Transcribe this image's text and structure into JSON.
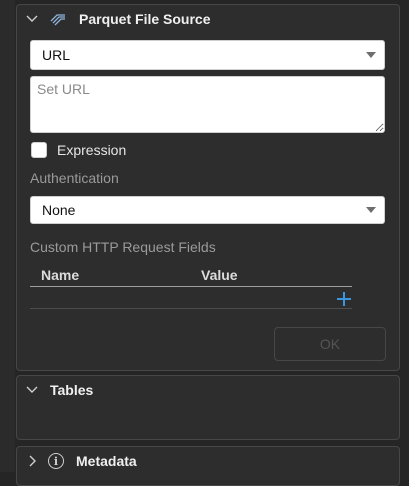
{
  "parquet_panel": {
    "title": "Parquet File Source",
    "source_type": {
      "selected": "URL"
    },
    "url": {
      "value": "",
      "placeholder": "Set URL"
    },
    "expression": {
      "label": "Expression",
      "checked": false
    },
    "authentication": {
      "label": "Authentication",
      "selected": "None"
    },
    "custom_fields": {
      "label": "Custom HTTP Request Fields",
      "columns": [
        "Name",
        "Value"
      ],
      "rows": []
    },
    "ok_label": "OK"
  },
  "tables_panel": {
    "title": "Tables"
  },
  "metadata_panel": {
    "title": "Metadata"
  },
  "colors": {
    "accent": "#3a96dd",
    "panel_bg": "#2d2d2d",
    "app_bg": "#252526"
  },
  "icons": [
    "chevron-down-icon",
    "parquet-icon",
    "plus-icon",
    "chevron-right-icon",
    "info-icon"
  ]
}
